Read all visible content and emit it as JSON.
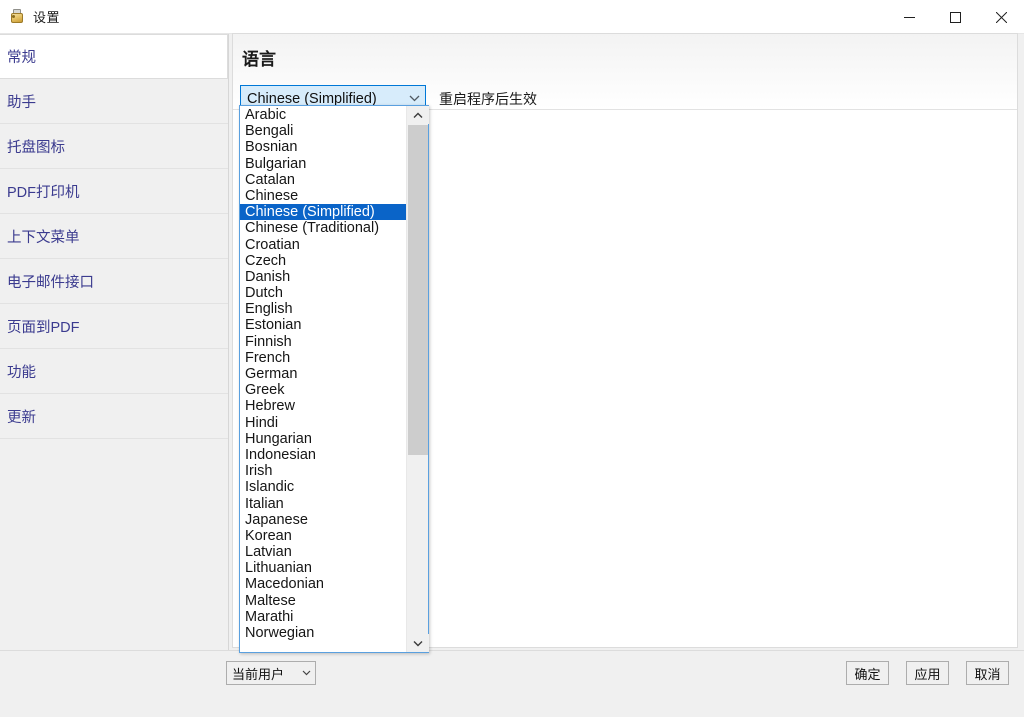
{
  "window": {
    "title": "设置",
    "icon": "settings-app-icon",
    "controls": {
      "minimize": "minimize-icon",
      "maximize": "maximize-icon",
      "close": "close-icon"
    }
  },
  "sidebar": {
    "items": [
      {
        "label": "常规",
        "selected": true
      },
      {
        "label": "助手",
        "selected": false
      },
      {
        "label": "托盘图标",
        "selected": false
      },
      {
        "label": "PDF打印机",
        "selected": false
      },
      {
        "label": "上下文菜单",
        "selected": false
      },
      {
        "label": "电子邮件接口",
        "selected": false
      },
      {
        "label": "页面到PDF",
        "selected": false
      },
      {
        "label": "功能",
        "selected": false
      },
      {
        "label": "更新",
        "selected": false
      }
    ]
  },
  "panel": {
    "title": "语言",
    "hint": "重启程序后生效",
    "language_combo": {
      "value": "Chinese (Simplified)",
      "arrow_icon": "chevron-down-icon",
      "expanded": true
    }
  },
  "dropdown": {
    "selected": "Chinese (Simplified)",
    "scrollbar": {
      "up_icon": "chevron-up-icon",
      "down_icon": "chevron-down-icon"
    },
    "options": [
      "Arabic",
      "Bengali",
      "Bosnian",
      "Bulgarian",
      "Catalan",
      "Chinese",
      "Chinese (Simplified)",
      "Chinese (Traditional)",
      "Croatian",
      "Czech",
      "Danish",
      "Dutch",
      "English",
      "Estonian",
      "Finnish",
      "French",
      "German",
      "Greek",
      "Hebrew",
      "Hindi",
      "Hungarian",
      "Indonesian",
      "Irish",
      "Islandic",
      "Italian",
      "Japanese",
      "Korean",
      "Latvian",
      "Lithuanian",
      "Macedonian",
      "Maltese",
      "Marathi",
      "Norwegian"
    ]
  },
  "footer": {
    "scope_combo": {
      "value": "当前用户",
      "arrow_icon": "chevron-down-icon"
    },
    "buttons": [
      {
        "label": "确定",
        "name": "ok-button"
      },
      {
        "label": "应用",
        "name": "apply-button"
      },
      {
        "label": "取消",
        "name": "cancel-button"
      }
    ]
  },
  "colors": {
    "selection_blue": "#0a64c8",
    "combo_focus_border": "#0078d7",
    "combo_focus_fill": "#d7ecfb",
    "sidebar_text": "#3b3b8f",
    "chrome_gray": "#f0f0f0"
  }
}
